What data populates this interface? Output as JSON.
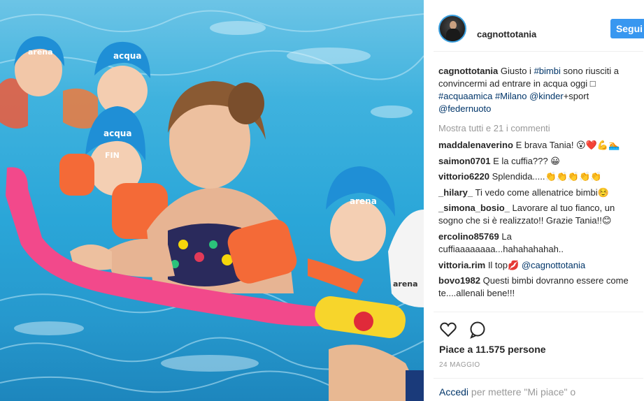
{
  "post": {
    "username": "cagnottotania",
    "follow_label": "Segui",
    "caption": {
      "user": "cagnottotania",
      "text": "Giusto i",
      "tag1": "#bimbi",
      "text2": "sono riusciti a convincermi ad entrare in acqua oggi □",
      "tag2": "#acquaamica",
      "tag3": "#Milano",
      "mention1": "@kinder",
      "text3": "+sport",
      "mention2": "@federnuoto"
    },
    "view_all_comments": "Mostra tutti e 21 i commenti",
    "comments": [
      {
        "user": "maddalenaverino",
        "text": "E brava Tania! 😮❤️💪🏊"
      },
      {
        "user": "saimon0701",
        "text": "E la cuffia??? 😀"
      },
      {
        "user": "vittorio6220",
        "text": "Splendida.....👏👏👏👏👏"
      },
      {
        "user": "_hilary_",
        "text": "Ti vedo come allenatrice bimbi☺️"
      },
      {
        "user": "_simona_bosio_",
        "text": "Lavorare al tuo fianco, un sogno che si è realizzato!! Grazie Tania!!😊"
      },
      {
        "user": "ercolino85769",
        "text": "La cuffiaaaaaaaa...hahahahahah.."
      },
      {
        "user": "vittoria.rim",
        "text": "Il top💋",
        "mention": "@cagnottotania"
      },
      {
        "user": "bovo1982",
        "text": "Questi bimbi dovranno essere come te....allenali bene!!!"
      }
    ],
    "likes": "Piace a 11.575 persone",
    "date": "24 MAGGIO",
    "login_link": "Accedi",
    "login_text": "per mettere \"Mi piace\" o"
  },
  "icons": {
    "like": "heart-icon",
    "comment": "comment-bubble-icon"
  }
}
